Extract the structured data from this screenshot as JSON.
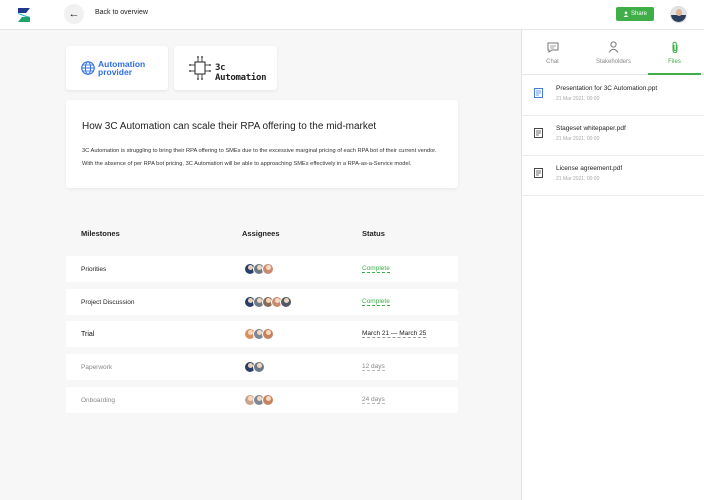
{
  "header": {
    "back_label": "Back to overview",
    "share_label": "Share"
  },
  "colors": {
    "accent": "#3fae49",
    "brand_blue": "#2f6fe0"
  },
  "partners": [
    {
      "name": "Automation provider",
      "line1": "Automation",
      "line2": "provider"
    },
    {
      "name": "3c Automation"
    }
  ],
  "summary": {
    "title": "How 3C Automation can scale their RPA offering to the mid-market",
    "body": "3C Automation is struggling to bring their RPA offering to SMEs due to the excessive marginal pricing of each RPA bot of their current vendor. With the absence of per RPA bot pricing, 3C Automation will be able to approaching SMEs effectively in a RPA-as-a-Service model."
  },
  "table": {
    "headers": [
      "Milestones",
      "Assignees",
      "Status"
    ],
    "rows": [
      {
        "name": "Priorities",
        "status": "Complete",
        "status_type": "complete",
        "assignees": [
          "#2a3f66",
          "#6d7a85",
          "#c98c73"
        ]
      },
      {
        "name": "Project Discussion",
        "status": "Complete",
        "status_type": "complete",
        "assignees": [
          "#2a3f66",
          "#6d7a85",
          "#8a6e5a",
          "#c98c73",
          "#505a66"
        ]
      },
      {
        "name": "Trial",
        "status": "March 21 — March 25",
        "status_type": "date",
        "assignees": [
          "#d99063",
          "#7c8794",
          "#c4835f"
        ]
      },
      {
        "name": "Paperwork",
        "status": "12 days",
        "status_type": "days",
        "assignees": [
          "#2a3f66",
          "#6d7a85"
        ]
      },
      {
        "name": "Onboarding",
        "status": "24 days",
        "status_type": "days",
        "assignees": [
          "#c9a48c",
          "#7c8794",
          "#c4835f"
        ]
      }
    ]
  },
  "panel": {
    "tabs": [
      {
        "label": "Chat",
        "icon": "chat-icon"
      },
      {
        "label": "Stakeholders",
        "icon": "person-icon"
      },
      {
        "label": "Files",
        "icon": "paperclip-icon",
        "active": true
      }
    ],
    "files": [
      {
        "name": "Presentation for 3C Automation.ppt",
        "date": "21 Mar 2021, 00:00",
        "icon": "presentation-file-icon"
      },
      {
        "name": "Stageset whitepaper.pdf",
        "date": "21 Mar 2021, 00:00",
        "icon": "document-file-icon"
      },
      {
        "name": "License agreement.pdf",
        "date": "21 Mar 2021, 00:00",
        "icon": "document-file-icon"
      }
    ]
  }
}
